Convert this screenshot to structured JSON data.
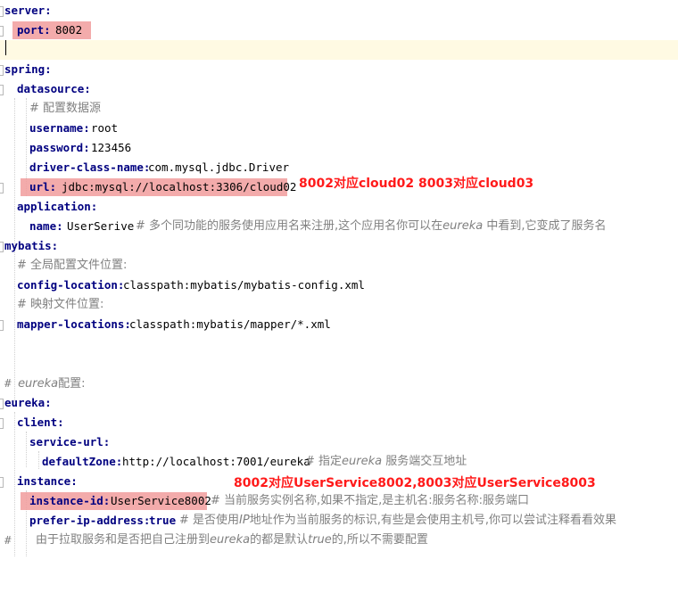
{
  "lines": {
    "l1_key": "server:",
    "l2_key": "port:",
    "l2_val": "8002",
    "l4_key": "spring:",
    "l5_key": "datasource:",
    "l6_comment": "# 配置数据源",
    "l7_key": "username:",
    "l7_val": "root",
    "l8_key": "password:",
    "l8_val": "123456",
    "l9_key": "driver-class-name:",
    "l9_val": "com.mysql.jdbc.Driver",
    "l10_key": "url:",
    "l10_val": "jdbc:mysql://localhost:3306/cloud02",
    "l11_key": "application:",
    "l12_key": "name:",
    "l12_val": "UserSerive",
    "l12_comment_a": "# 多个同功能的服务使用应用名来注册,这个应用名你可以在",
    "l12_comment_b": "eureka",
    "l12_comment_c": " 中看到,它变成了服务名",
    "l13_key": "mybatis:",
    "l14_comment": "# 全局配置文件位置:",
    "l15_key": "config-location:",
    "l15_val": "classpath:mybatis/mybatis-config.xml",
    "l16_comment": "# 映射文件位置:",
    "l17_key": "mapper-locations:",
    "l17_val": "classpath:mybatis/mapper/*.xml",
    "l20_comment_a": "# ",
    "l20_comment_b": "eureka",
    "l20_comment_c": "配置:",
    "l21_key": "eureka:",
    "l22_key": "client:",
    "l23_key": "service-url:",
    "l24_key": "defaultZone:",
    "l24_val": "http://localhost:7001/eureka",
    "l24_comment_a": "# 指定",
    "l24_comment_b": "eureka",
    "l24_comment_c": " 服务端交互地址",
    "l25_key": "instance:",
    "l26_key": "instance-id:",
    "l26_val": "UserService8002",
    "l26_comment": "# 当前服务实例名称,如果不指定,是主机名:服务名称:服务端口",
    "l27_key": "prefer-ip-address:",
    "l27_val": "true",
    "l27_comment_a": "# 是否使用",
    "l27_comment_b": "IP",
    "l27_comment_c": "地址作为当前服务的标识,有些是会使用主机号,你可以尝试注释看看效果",
    "l28_hash": "#",
    "l28_comment_a": "由于拉取服务和是否把自己注册到",
    "l28_comment_b": "eureka",
    "l28_comment_c": "的都是默认",
    "l28_comment_d": "true",
    "l28_comment_e": "的,所以不需要配置"
  },
  "annotations": {
    "note_url": "8002对应cloud02 8003对应cloud03",
    "note_instance": "8002对应UserService8002,8003对应UserService8003",
    "highlight_color": "#f19c9c",
    "note_color": "#ff1a1a"
  }
}
